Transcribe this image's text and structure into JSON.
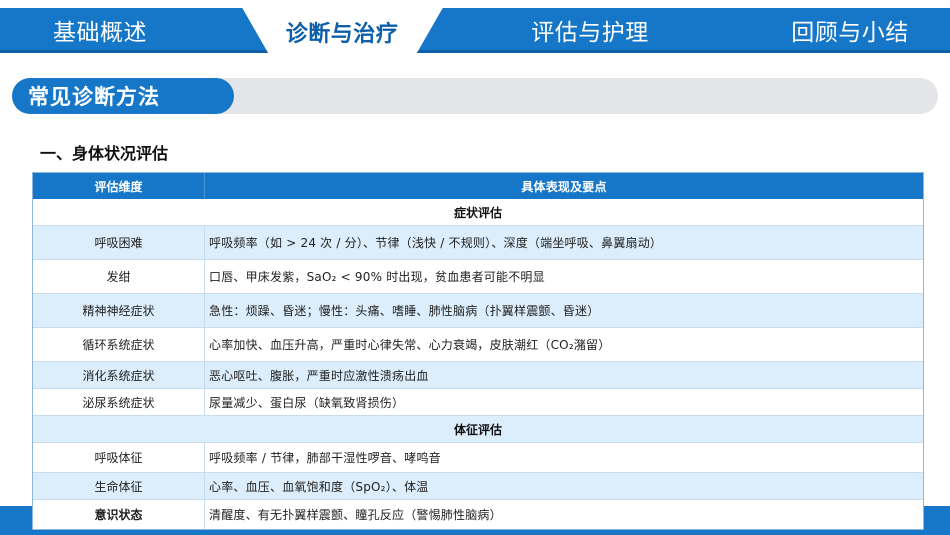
{
  "nav": {
    "tabs": [
      {
        "label": "基础概述",
        "active": false
      },
      {
        "label": "诊断与治疗",
        "active": true
      },
      {
        "label": "评估与护理",
        "active": false
      },
      {
        "label": "回顾与小结",
        "active": false
      }
    ]
  },
  "section": {
    "title": "常见诊断方法"
  },
  "subheading": "一、身体状况评估",
  "table": {
    "headers": [
      "评估维度",
      "具体表现及要点"
    ],
    "rows": [
      {
        "type": "group",
        "label": "症状评估"
      },
      {
        "type": "data",
        "dimension": "呼吸困难",
        "detail": "呼吸频率（如 > 24 次 / 分）、节律（浅快 / 不规则）、深度（端坐呼吸、鼻翼扇动）"
      },
      {
        "type": "data",
        "dimension": "发绀",
        "detail": "口唇、甲床发紫，SaO₂ < 90% 时出现，贫血患者可能不明显"
      },
      {
        "type": "data",
        "dimension": "精神神经症状",
        "detail": "急性：烦躁、昏迷；慢性：头痛、嗜睡、肺性脑病（扑翼样震颤、昏迷）"
      },
      {
        "type": "data",
        "dimension": "循环系统症状",
        "detail": "心率加快、血压升高，严重时心律失常、心力衰竭，皮肤潮红（CO₂潴留）"
      },
      {
        "type": "data",
        "dimension": "消化系统症状",
        "detail": "恶心呕吐、腹胀，严重时应激性溃疡出血"
      },
      {
        "type": "data",
        "dimension": "泌尿系统症状",
        "detail": "尿量减少、蛋白尿（缺氧致肾损伤）"
      },
      {
        "type": "group",
        "label": "体征评估"
      },
      {
        "type": "data",
        "dimension": "呼吸体征",
        "detail": "呼吸频率 / 节律，肺部干湿性啰音、哮鸣音"
      },
      {
        "type": "data",
        "dimension": "生命体征",
        "detail": "心率、血压、血氧饱和度（SpO₂）、体温"
      },
      {
        "type": "data",
        "dimension": "意识状态",
        "detail": "清醒度、有无扑翼样震颤、瞳孔反应（警惕肺性脑病）",
        "bold_dimension": true
      }
    ]
  },
  "colors": {
    "accent": "#1677c9",
    "row_alt": "#dceefb",
    "track": "#e3e5e8"
  }
}
